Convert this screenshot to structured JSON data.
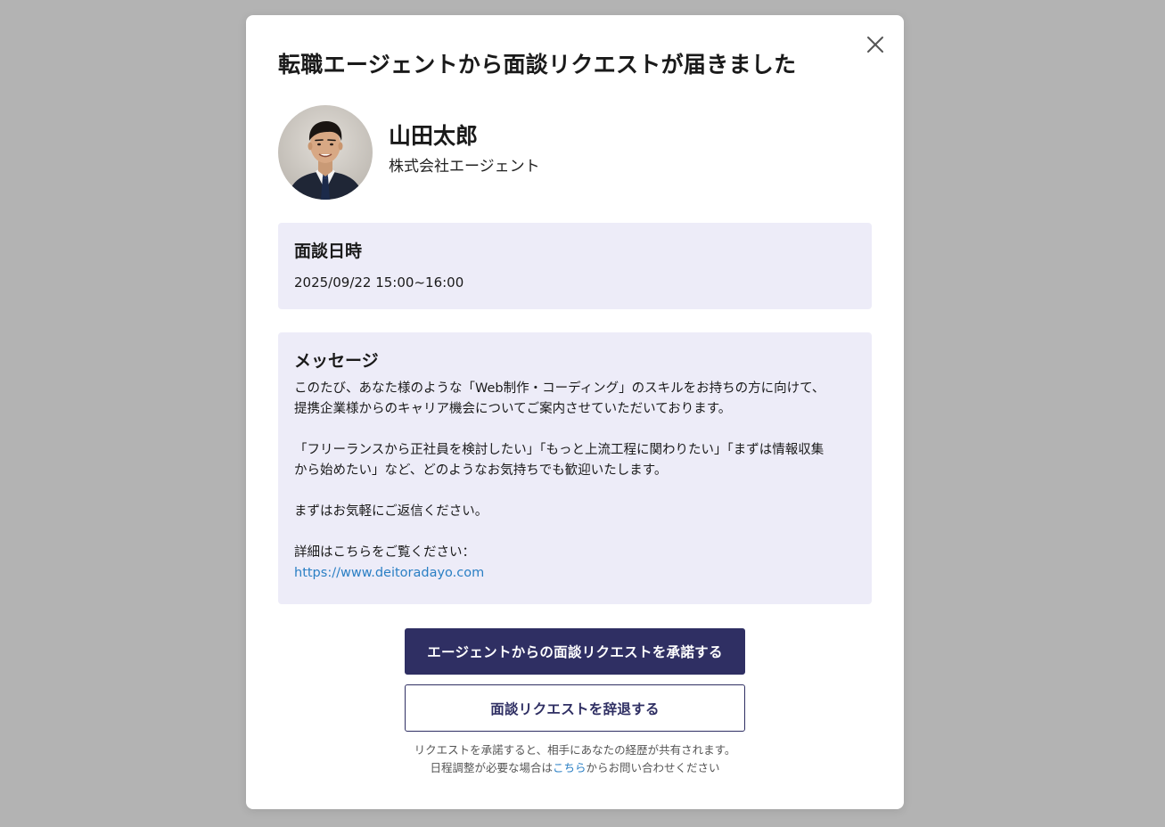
{
  "modal": {
    "title": "転職エージェントから面談リクエストが届きました",
    "close_icon": "close-icon"
  },
  "agent": {
    "name": "山田太郎",
    "company": "株式会社エージェント",
    "avatar_icon": "avatar-photo"
  },
  "interview": {
    "heading": "面談日時",
    "datetime": "2025/09/22 15:00~16:00"
  },
  "message": {
    "heading": "メッセージ",
    "line1": "このたび、あなた様のような「Web制作・コーディング」のスキルをお持ちの方に向けて、",
    "line2": "提携企業様からのキャリア機会についてご案内させていただいております。",
    "line3": "「フリーランスから正社員を検討したい」「もっと上流工程に関わりたい」「まずは情報収集",
    "line4": "から始めたい」など、どのようなお気持ちでも歓迎いたします。",
    "line5": "まずはお気軽にご返信ください。",
    "line6": "詳細はこちらをご覧ください：",
    "link": "https://www.deitoradayo.com"
  },
  "actions": {
    "accept_label": "エージェントからの面談リクエストを承諾する",
    "decline_label": "面談リクエストを辞退する"
  },
  "footnote": {
    "line1": "リクエストを承諾すると、相手にあなたの経歴が共有されます。",
    "line2_before": "日程調整が必要な場合は",
    "line2_link": "こちら",
    "line2_after": "からお問い合わせください"
  },
  "colors": {
    "backdrop": "#b3b3b3",
    "panel": "#edecf8",
    "primary": "#2f2f63",
    "link": "#2a7fc4"
  }
}
